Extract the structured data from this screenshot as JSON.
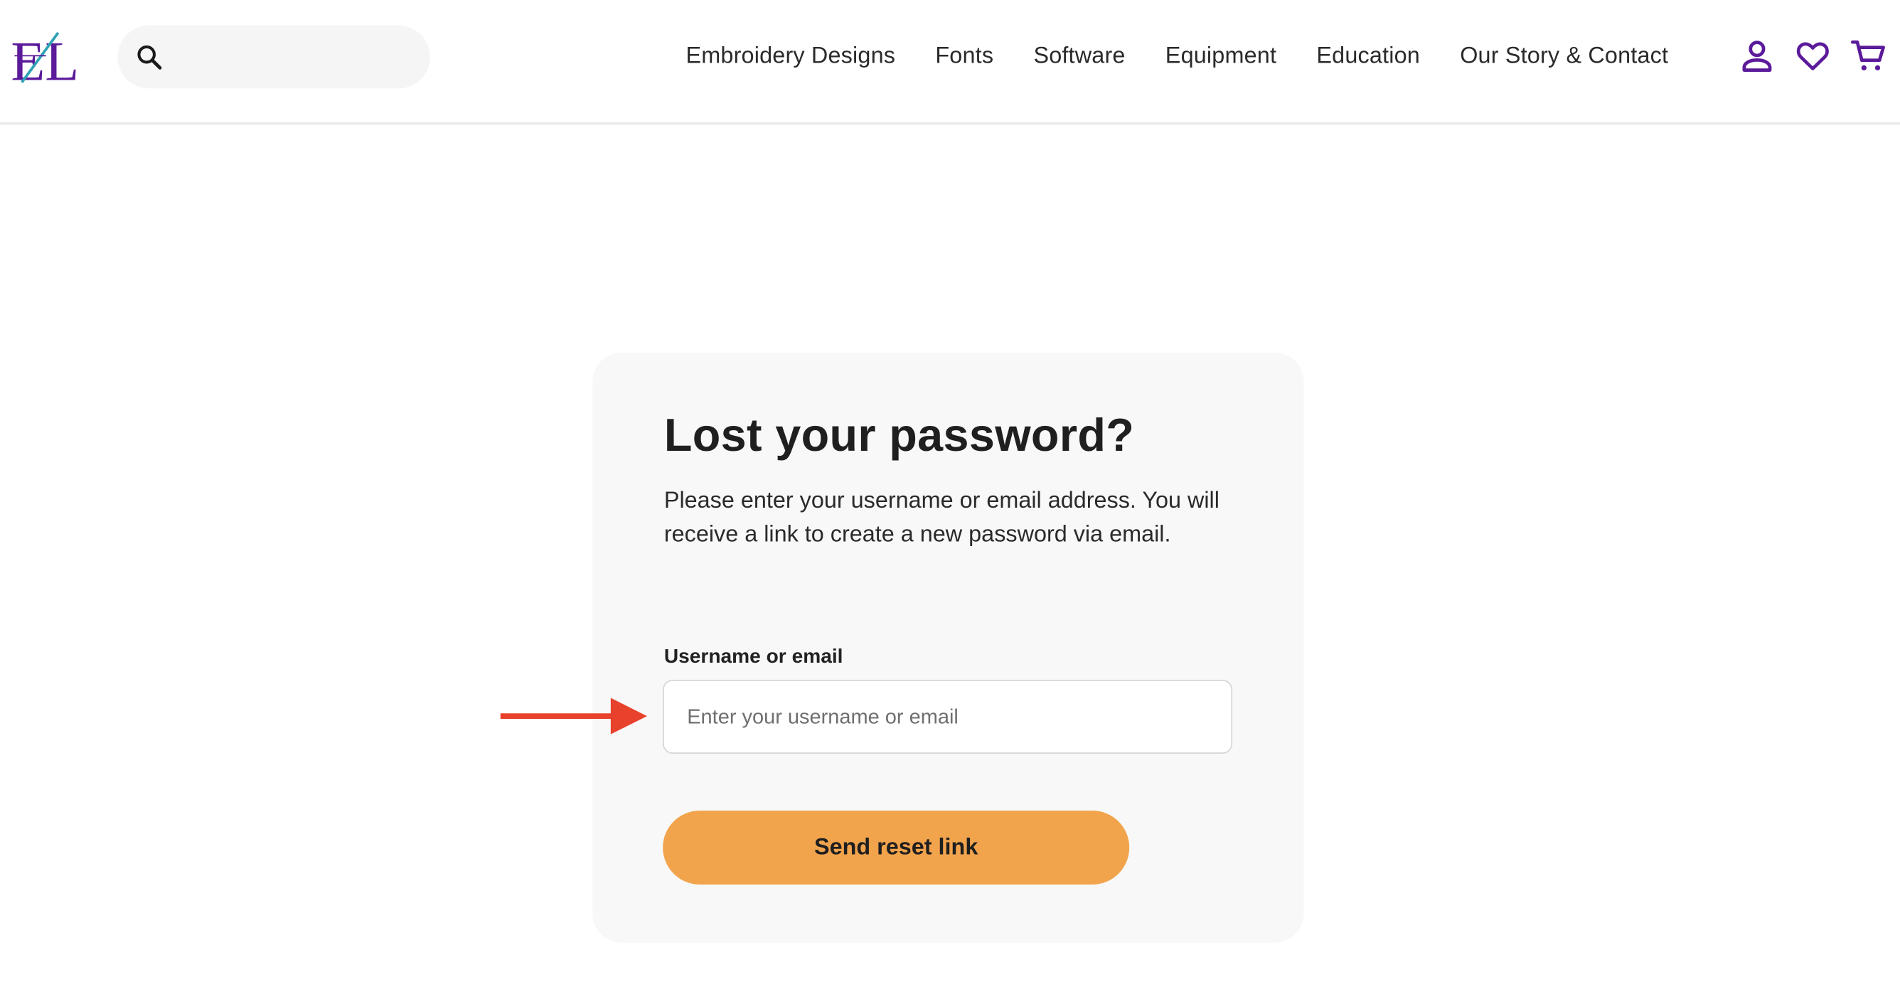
{
  "header": {
    "logo_text": "EL",
    "search": {
      "placeholder": "",
      "value": ""
    },
    "nav": [
      {
        "label": "Embroidery Designs"
      },
      {
        "label": "Fonts"
      },
      {
        "label": "Software"
      },
      {
        "label": "Equipment"
      },
      {
        "label": "Education"
      },
      {
        "label": "Our Story & Contact"
      }
    ],
    "icons": [
      "account-icon",
      "wishlist-heart-icon",
      "cart-icon"
    ]
  },
  "form": {
    "title": "Lost your password?",
    "description": "Please enter your username or email address. You will receive a link to create a new password via email.",
    "field_label": "Username or email",
    "field_placeholder": "Enter your username or email",
    "field_value": "",
    "submit_label": "Send reset link"
  },
  "annotation": {
    "type": "arrow",
    "points_to": "username-email-input",
    "color": "#e8412c"
  },
  "colors": {
    "brand_purple": "#5b1a9a",
    "brand_teal": "#2fa3b5",
    "button_orange": "#f2a44d",
    "card_bg": "#f8f8f8"
  }
}
